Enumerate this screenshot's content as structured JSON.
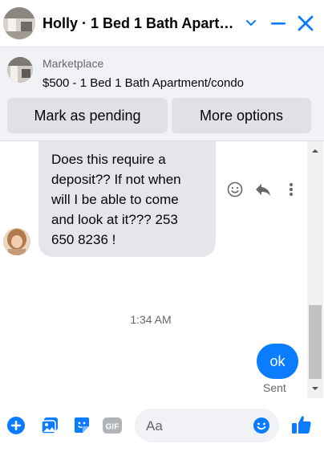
{
  "header": {
    "title": "Holly · 1 Bed 1 Bath Apart…",
    "avatar_icon": "apartment-photo-avatar",
    "buttons": [
      "chevron-down-icon",
      "minimize-icon",
      "close-icon"
    ],
    "accent_color": "#0a7cff"
  },
  "listing": {
    "label": "Marketplace",
    "title": "$500 - 1 Bed 1 Bath Apartment/condo",
    "actions": {
      "pending": "Mark as pending",
      "more": "More options"
    }
  },
  "conversation": {
    "incoming": {
      "lines": [
        "Does this require a",
        "deposit?? If not when",
        "will I be able to come",
        "and look at it??? 253",
        "650 8236 !"
      ],
      "reactions": [
        "smile-icon",
        "reply-icon",
        "more-vertical-icon"
      ]
    },
    "timestamp": "1:34 AM",
    "outgoing": {
      "text": "ok",
      "status": "Sent"
    }
  },
  "composer": {
    "tools": [
      "plus-circle-icon",
      "photo-icon",
      "sticker-icon",
      "gif-icon"
    ],
    "placeholder": "Aa",
    "emoji_icon": "emoji-icon",
    "like_icon": "thumbs-up-icon"
  }
}
